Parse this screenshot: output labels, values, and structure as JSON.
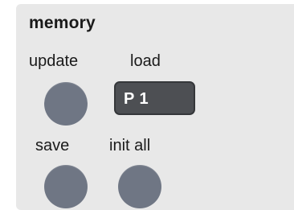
{
  "panel": {
    "title": "memory",
    "update_label": "update",
    "load_label": "load",
    "save_label": "save",
    "init_all_label": "init all",
    "preset_value": "P 1"
  },
  "colors": {
    "panel_bg": "#e8e8e8",
    "knob": "#6f7684",
    "dropdown_bg": "#4d4f53",
    "dropdown_text": "#ffffff"
  }
}
